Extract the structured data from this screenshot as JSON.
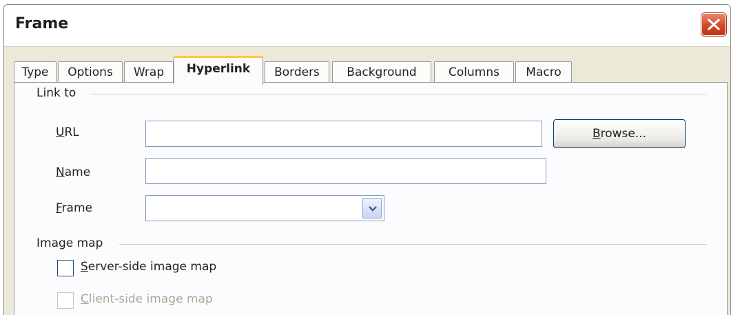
{
  "window": {
    "title": "Frame",
    "close_icon": "close-icon"
  },
  "tabs": [
    {
      "label": "Type",
      "active": false
    },
    {
      "label": "Options",
      "active": false
    },
    {
      "label": "Wrap",
      "active": false
    },
    {
      "label": "Hyperlink",
      "active": true
    },
    {
      "label": "Borders",
      "active": false
    },
    {
      "label": "Background",
      "active": false
    },
    {
      "label": "Columns",
      "active": false
    },
    {
      "label": "Macro",
      "active": false
    }
  ],
  "link_to": {
    "group_label": "Link to",
    "url": {
      "label_mnemonic": "U",
      "label_rest": "RL",
      "value": ""
    },
    "browse": {
      "label_mnemonic": "B",
      "label_rest": "rowse..."
    },
    "name": {
      "label_mnemonic": "N",
      "label_rest": "ame",
      "value": ""
    },
    "frame": {
      "label_mnemonic": "F",
      "label_rest": "rame",
      "selected": ""
    }
  },
  "image_map": {
    "group_label": "Image map",
    "server_side": {
      "label_mnemonic": "S",
      "label_rest": "erver-side image map",
      "checked": false,
      "enabled": true
    },
    "client_side": {
      "label_mnemonic": "C",
      "label_rest": "lient-side image map",
      "checked": false,
      "enabled": false
    }
  },
  "colors": {
    "active_tab_accent": "#ffc83c",
    "close_button": "#d4472a",
    "dialog_bg": "#ece9d8",
    "panel_bg": "#fcfcfe"
  }
}
